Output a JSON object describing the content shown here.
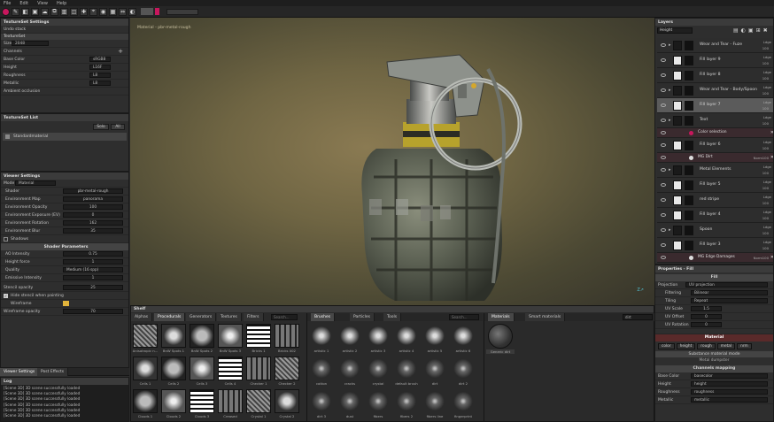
{
  "menu": [
    "File",
    "Edit",
    "View",
    "Help"
  ],
  "textureset_settings": {
    "title": "TextureSet Settings",
    "undo": "Undo stack",
    "textureset_label": "TextureSet",
    "size_label": "Size",
    "size_value": "2048",
    "channels_label": "Channels",
    "channels": [
      {
        "name": "Base Color",
        "format": "sRGB8"
      },
      {
        "name": "Height",
        "format": "L16F"
      },
      {
        "name": "Roughness",
        "format": "L8"
      },
      {
        "name": "Metallic",
        "format": "L8"
      },
      {
        "name": "Ambient occlusion",
        "format": ""
      }
    ]
  },
  "textureset_list": {
    "title": "TextureSet List",
    "solo": "Solo",
    "all": "All",
    "item": "Standardmaterial"
  },
  "viewer_settings": {
    "title": "Viewer Settings",
    "mode_label": "Mode",
    "mode_value": "Material",
    "rows": [
      {
        "label": "Shader",
        "value": "pbr-metal-rough"
      },
      {
        "label": "Environment Map",
        "value": "panorama"
      },
      {
        "label": "Environment Opacity",
        "value": "100"
      },
      {
        "label": "Environment Exposure (EV)",
        "value": "0"
      },
      {
        "label": "Environment Rotation",
        "value": "162"
      },
      {
        "label": "Environment Blur",
        "value": "35"
      },
      {
        "label": "Shadows",
        "value": ""
      }
    ],
    "shader_params_title": "Shader Parameters",
    "params": [
      {
        "label": "AO Intensity",
        "value": "0.75"
      },
      {
        "label": "Height force",
        "value": "1"
      },
      {
        "label": "Quality",
        "value": "Medium (16 spp)"
      },
      {
        "label": "Emissive Intensity",
        "value": "1"
      }
    ],
    "stencil_label": "Stencil opacity",
    "stencil_value": "25",
    "hide_stencil": "Hide stencil when painting",
    "wireframe": "Wireframe",
    "wireframe_opacity_label": "Wireframe opacity",
    "wireframe_opacity_value": "70"
  },
  "bottom_tabs": [
    "Viewer Settings",
    "Post Effects"
  ],
  "log": {
    "title": "Log",
    "lines": [
      "[Scene 3D] 3D scene successfully loaded",
      "[Scene 3D] 3D scene successfully loaded",
      "[Scene 3D] 3D scene successfully loaded",
      "[Scene 3D] 3D scene successfully loaded",
      "[Scene 3D] 3D scene successfully loaded",
      "[Scene 3D] 3D scene successfully loaded"
    ]
  },
  "viewport": {
    "label": "Material - pbr-metal-rough"
  },
  "shelf": {
    "title": "Shelf",
    "tabs": [
      "Alphas",
      "Procedurals",
      "Generators",
      "Textures",
      "Filters"
    ],
    "search": "Search...",
    "procedurals": [
      "Anisotropic n...",
      "BnW Spots 1",
      "BnW Spots 2",
      "BnW Spots 3",
      "Bricks 1",
      "Bricks 002",
      "Cells 1",
      "Cells 2",
      "Cells 3",
      "Cells 4",
      "Checker 1",
      "Checker 2",
      "Clouds 1",
      "Clouds 2",
      "Clouds 3",
      "Creased",
      "Crystal 1",
      "Crystal 2"
    ],
    "brush_tabs": [
      "Brushes",
      "Particles",
      "Tools"
    ],
    "brush_search": "Search...",
    "brushes": [
      "artistic 1",
      "artistic 2",
      "artistic 3",
      "artistic 4",
      "artistic 5",
      "artistic 6",
      "cotton",
      "cracks",
      "crystal",
      "default brush",
      "dirt",
      "dirt 2",
      "dirt 3",
      "dust",
      "fibers",
      "fibers 2",
      "fibers line",
      "fingerprint"
    ],
    "material_tabs": [
      "Materials",
      "Smart materials"
    ],
    "material_search": "dirt",
    "material_item": "Generic dirt"
  },
  "layers": {
    "title": "Layers",
    "channel": "Height",
    "items": [
      {
        "name": "Wear and Tear - Fuze",
        "mode": "Ldge",
        "opacity": "100",
        "type": "folder"
      },
      {
        "name": "Fill layer 9",
        "mode": "Ldge",
        "opacity": "100",
        "type": "layer"
      },
      {
        "name": "Fill layer 8",
        "mode": "Ldge",
        "opacity": "100",
        "type": "layer"
      },
      {
        "name": "Wear and Tear - Body/Spoon",
        "mode": "Ldge",
        "opacity": "100",
        "type": "folder"
      },
      {
        "name": "Fill layer 7",
        "mode": "Ldge",
        "opacity": "100",
        "type": "selected"
      },
      {
        "name": "Text",
        "mode": "Ldge",
        "opacity": "100",
        "type": "folder"
      },
      {
        "name": "Color selection",
        "mode": "",
        "opacity": "",
        "type": "effect"
      },
      {
        "name": "Fill layer 6",
        "mode": "Ldge",
        "opacity": "100",
        "type": "layer"
      },
      {
        "name": "MG Dirt",
        "mode": "Norm",
        "opacity": "100",
        "type": "effect2"
      },
      {
        "name": "Metal Elements",
        "mode": "Ldge",
        "opacity": "100",
        "type": "folder"
      },
      {
        "name": "Fill layer 5",
        "mode": "Ldge",
        "opacity": "100",
        "type": "layer"
      },
      {
        "name": "red stripe",
        "mode": "Ldge",
        "opacity": "100",
        "type": "layer"
      },
      {
        "name": "Fill layer 4",
        "mode": "Ldge",
        "opacity": "100",
        "type": "layer"
      },
      {
        "name": "Spoon",
        "mode": "Ldge",
        "opacity": "100",
        "type": "folder"
      },
      {
        "name": "Fill layer 3",
        "mode": "Ldge",
        "opacity": "100",
        "type": "layer"
      },
      {
        "name": "MG Edge Damages",
        "mode": "Norm",
        "opacity": "100",
        "type": "effect2"
      }
    ]
  },
  "properties": {
    "title": "Properties - Fill",
    "fill": "Fill",
    "projection_label": "Projection",
    "projection_value": "UV projection",
    "filtering_label": "Filtering",
    "filtering_value": "Bilinear",
    "tiling_label": "Tiling",
    "tiling_value": "Repeat",
    "uvscale_label": "UV Scale",
    "uvscale_value": "1.5",
    "uvoffset_label": "UV Offset",
    "uvoffset_value": "0",
    "uvrotation_label": "UV Rotation",
    "uvrotation_value": "0",
    "material_title": "Material",
    "channel_buttons": [
      "color",
      "height",
      "rough",
      "metal",
      "nrm"
    ],
    "substance_mode": "Substance material mode",
    "substance_value": "Metal dumpster",
    "channels_mapping": "Channels mapping",
    "mapping": [
      {
        "label": "Base Color",
        "value": "basecolor"
      },
      {
        "label": "Height",
        "value": "height"
      },
      {
        "label": "Roughness",
        "value": "roughness"
      },
      {
        "label": "Metallic",
        "value": "metallic"
      }
    ]
  }
}
